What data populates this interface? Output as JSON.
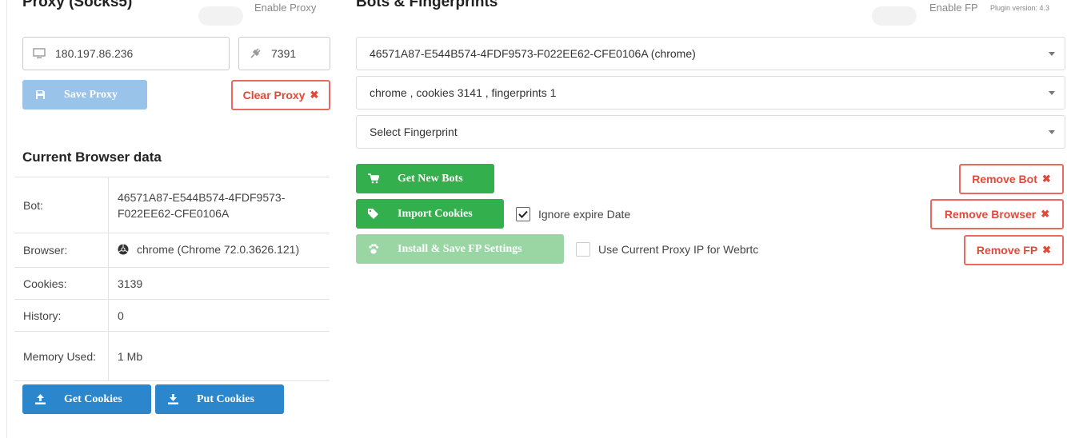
{
  "proxy": {
    "title": "Proxy (Socks5)",
    "enable_label": "Enable Proxy",
    "ip_value": "180.197.86.236",
    "port_value": "7391",
    "save_label": "Save Proxy",
    "clear_label": "Clear Proxy"
  },
  "browser_data": {
    "title": "Current Browser data",
    "rows": [
      {
        "key": "Bot:",
        "value": "46571A87-E544B574-4FDF9573-F022EE62-CFE0106A"
      },
      {
        "key": "Browser:",
        "value": "chrome (Chrome 72.0.3626.121)"
      },
      {
        "key": "Cookies:",
        "value": "3139"
      },
      {
        "key": "History:",
        "value": "0"
      },
      {
        "key": "Memory Used:",
        "value": "1 Mb"
      }
    ],
    "get_cookies_label": "Get Cookies",
    "put_cookies_label": "Put Cookies"
  },
  "bots": {
    "title": "Bots & Fingerprints",
    "enable_label": "Enable FP",
    "plugin_version": "Plugin version: 4.3",
    "select_bot": "46571A87-E544B574-4FDF9573-F022EE62-CFE0106A (chrome)",
    "select_browser": "chrome , cookies 3141 , fingerprints 1",
    "select_fingerprint": "Select Fingerprint",
    "get_new_bots_label": "Get New Bots",
    "import_cookies_label": "Import Cookies",
    "install_fp_label": "Install & Save FP Settings",
    "ignore_expire_label": "Ignore expire Date",
    "ignore_expire_checked": true,
    "use_proxy_ip_label": "Use Current Proxy IP for Webrtc",
    "use_proxy_ip_checked": false,
    "remove_bot_label": "Remove Bot",
    "remove_browser_label": "Remove Browser",
    "remove_fp_label": "Remove FP"
  },
  "colors": {
    "primary": "#2c86cb",
    "success": "#33b04d",
    "danger": "#e1493a"
  }
}
